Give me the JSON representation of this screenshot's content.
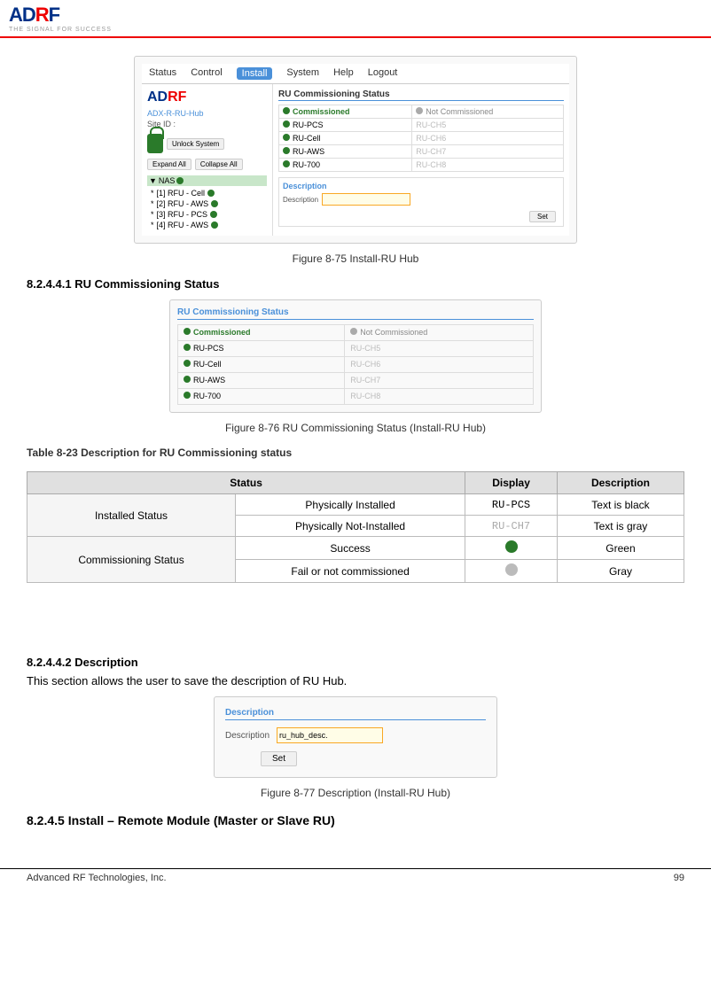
{
  "header": {
    "logo_main": "ADR",
    "logo_accent": "F",
    "tagline": "THE SIGNAL FOR SUCCESS"
  },
  "figure75": {
    "caption": "Figure 8-75   Install-RU Hub",
    "nav_items": [
      "Status",
      "Control",
      "Install",
      "System",
      "Help",
      "Logout"
    ],
    "active_nav": "Install",
    "sidebar": {
      "device": "ADX-R-RU-Hub",
      "site_label": "Site ID :",
      "unlock_btn": "Unlock System",
      "expand_btn": "Expand All",
      "collapse_btn": "Collapse All",
      "tree_root": "NAS",
      "tree_items": [
        "[1] RFU - Cell",
        "[2] RFU - AWS",
        "[3] RFU - PCS",
        "[4] RFU - AWS"
      ]
    },
    "main": {
      "section_title": "RU Commissioning Status",
      "commissioned_label": "Commissioned",
      "not_commissioned_label": "Not Commissioned",
      "ru_items_left": [
        "RU-PCS",
        "RU-Cell",
        "RU-AWS",
        "RU-700"
      ],
      "ru_items_right": [
        "RU-CH5",
        "RU-CH6",
        "RU-CH7",
        "RU-CH8"
      ],
      "desc_section_title": "Description",
      "desc_label": "Description",
      "set_btn": "Set"
    }
  },
  "section_8241": {
    "heading": "8.2.4.4.1   RU Commissioning Status",
    "figure76": {
      "caption": "Figure 8-76   RU Commissioning Status (Install-RU Hub)",
      "section_title": "RU Commissioning Status",
      "commissioned_label": "Commissioned",
      "not_commissioned_label": "Not Commissioned",
      "ru_items_left": [
        "RU-PCS",
        "RU-Cell",
        "RU-AWS",
        "RU-700"
      ],
      "ru_items_right": [
        "RU-CH5",
        "RU-CH6",
        "RU-CH7",
        "RU-CH8"
      ]
    }
  },
  "table823": {
    "caption": "Table 8-23    Description for RU Commissioning status",
    "headers": [
      "Status",
      "Display",
      "Description"
    ],
    "rows": [
      {
        "status_group": "Installed Status",
        "status_sub": "Physically Installed",
        "display_text": "RU-PCS",
        "display_style": "black",
        "description": "Text is black"
      },
      {
        "status_group": "",
        "status_sub": "Physically Not-Installed",
        "display_text": "RU-CH7",
        "display_style": "gray",
        "description": "Text is gray"
      },
      {
        "status_group": "Commissioning  Status",
        "status_sub": "Success",
        "display_text": "",
        "display_style": "green-dot",
        "description": "Green"
      },
      {
        "status_group": "",
        "status_sub": "Fail or not commissioned",
        "display_text": "",
        "display_style": "gray-dot",
        "description": "Gray"
      }
    ]
  },
  "section_8242": {
    "heading": "8.2.4.4.2    Description",
    "body_text": "This section allows the user to save the description of RU Hub.",
    "figure77": {
      "caption": "Figure 8-77   Description (Install-RU Hub)",
      "section_title": "Description",
      "desc_label": "Description",
      "desc_value": "ru_hub_desc.",
      "set_btn": "Set"
    }
  },
  "section_845": {
    "heading": "8.2.4.5   Install – Remote Module (Master or Slave RU)"
  },
  "footer": {
    "company": "Advanced RF Technologies, Inc.",
    "page": "99"
  }
}
